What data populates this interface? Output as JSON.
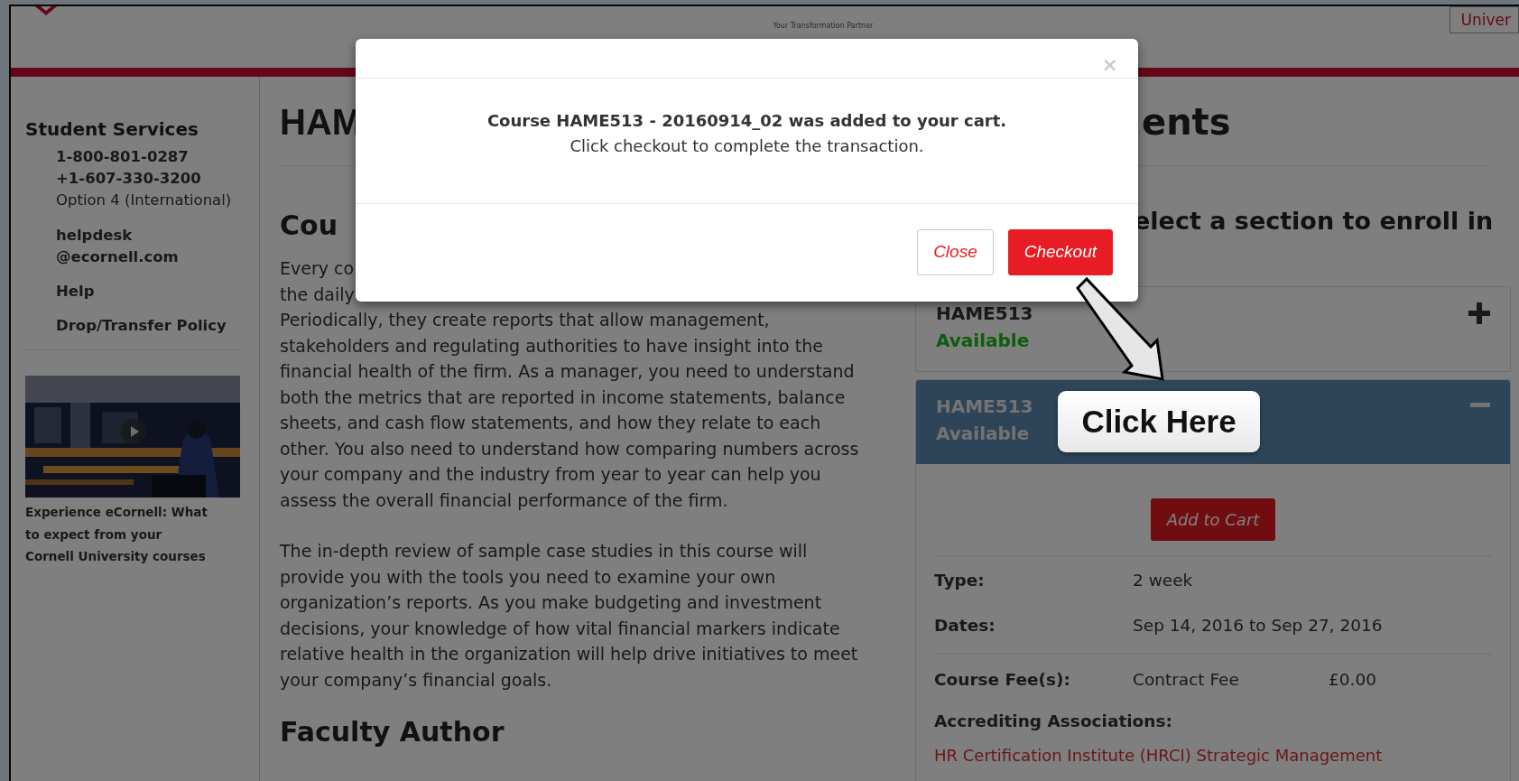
{
  "header": {
    "tagline": "Your Transformation Partner",
    "top_button": "Univer"
  },
  "sidebar": {
    "title": "Student Services",
    "contact_lines": [
      "1-800-801-0287",
      "+1-607-330-3200",
      "Option 4 (International)"
    ],
    "email_lines": [
      "helpdesk",
      "@ecornell.com"
    ],
    "links": [
      "Help",
      "Drop/Transfer Policy"
    ],
    "video": {
      "kind": "picture"
    },
    "caption": "Experience eCornell: What to expect from your Cornell University courses"
  },
  "main": {
    "heading_fragment": "HAM",
    "section_fragment": "Cou",
    "partial_lines": [
      "Every co",
      "the daily"
    ],
    "paragraphs": [
      "Periodically, they create reports that allow management, stakeholders and regulating authorities to have insight into the financial health of the firm. As a manager, you need to understand both the metrics that are reported in income statements, balance sheets, and cash flow statements, and how they relate to each other. You also need to understand how comparing numbers across your company and the industry from year to year can help you assess the overall financial performance of the firm.",
      "The in-depth review of sample case studies in this course will provide you with the tools you need to examine your own organization’s reports. As you make budgeting and investment decisions, your knowledge of how vital financial markers indicate relative health in the organization will help drive initiatives to meet your company’s financial goals."
    ],
    "next_heading": "Faculty Author"
  },
  "right": {
    "heading_fragment": "ents",
    "subheading_fragment": "elect a section to enroll in",
    "sections": [
      {
        "code": "HAME513",
        "status": "Available",
        "expanded": false
      },
      {
        "code": "HAME513",
        "status": "Available",
        "expanded": true,
        "button": "Add to Cart",
        "details": [
          {
            "label": "Type:",
            "value": "2 week"
          },
          {
            "label": "Dates:",
            "value": "Sep 14, 2016 to Sep 27, 2016"
          }
        ],
        "fees": [
          {
            "label": "Course Fee(s):",
            "value": "Contract Fee",
            "amount": "£0.00"
          }
        ],
        "accreditation_label": "Accrediting Associations:",
        "accreditations": [
          "HR Certification Institute (HRCI) Strategic Management"
        ]
      }
    ]
  },
  "modal": {
    "close_symbol": "×",
    "message_bold": "Course HAME513 - 20160914_02 was added to your cart.",
    "message": "Click checkout to complete the transaction.",
    "buttons": [
      {
        "label": "Close",
        "kind": "secondary"
      },
      {
        "label": "Checkout",
        "kind": "primary"
      }
    ]
  },
  "callout": {
    "label": "Click Here"
  }
}
